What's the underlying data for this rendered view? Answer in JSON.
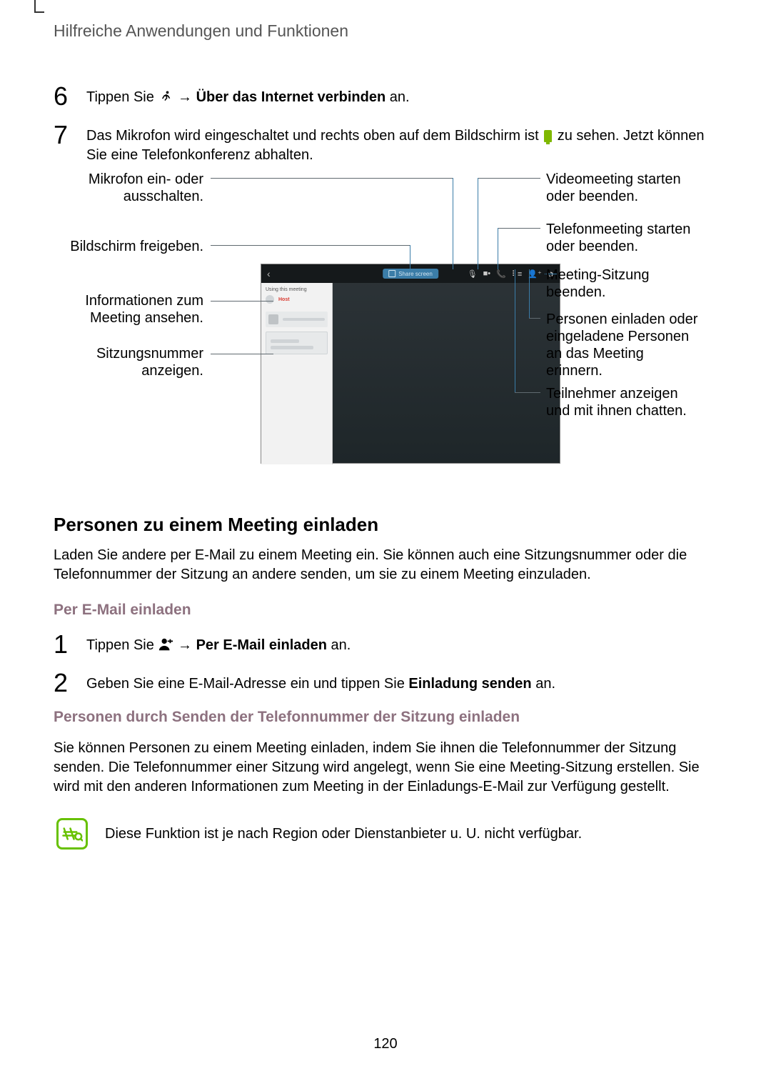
{
  "header": {
    "title": "Hilfreiche Anwendungen und Funktionen"
  },
  "step6": {
    "num": "6",
    "a": "Tippen Sie ",
    "arrow": "→",
    "b": "Über das Internet verbinden",
    "c": " an."
  },
  "step7": {
    "num": "7",
    "a": "Das Mikrofon wird eingeschaltet und rechts oben auf dem Bildschirm ist ",
    "b": " zu sehen. Jetzt können Sie eine Telefonkonferenz abhalten."
  },
  "callouts": {
    "left": {
      "mic": "Mikrofon ein- oder ausschalten.",
      "share": "Bildschirm freigeben.",
      "info": "Informationen zum Meeting ansehen.",
      "session_no": "Sitzungsnummer anzeigen."
    },
    "right": {
      "video": "Videomeeting starten oder beenden.",
      "phone": "Telefonmeeting starten oder beenden.",
      "end": "Meeting-Sitzung beenden.",
      "invite": "Personen einladen oder eingeladene Personen an das Meeting erinnern.",
      "participants_chat": "Teilnehmer anzeigen und mit ihnen chatten."
    }
  },
  "shot": {
    "share_label": "Share screen",
    "side_title": "Using this meeting",
    "host_badge": "Host"
  },
  "section": {
    "heading": "Personen zu einem Meeting einladen",
    "intro": "Laden Sie andere per E-Mail zu einem Meeting ein. Sie können auch eine Sitzungsnummer oder die Telefonnummer der Sitzung an andere senden, um sie zu einem Meeting einzuladen."
  },
  "email": {
    "heading": "Per E-Mail einladen",
    "step1": {
      "num": "1",
      "a": "Tippen Sie ",
      "arrow": "→",
      "b": "Per E-Mail einladen",
      "c": " an."
    },
    "step2": {
      "num": "2",
      "a": "Geben Sie eine E-Mail-Adresse ein und tippen Sie ",
      "b": "Einladung senden",
      "c": " an."
    }
  },
  "phone_invite": {
    "heading": "Personen durch Senden der Telefonnummer der Sitzung einladen",
    "body": "Sie können Personen zu einem Meeting einladen, indem Sie ihnen die Telefonnummer der Sitzung senden. Die Telefonnummer einer Sitzung wird angelegt, wenn Sie eine Meeting-Sitzung erstellen. Sie wird mit den anderen Informationen zum Meeting in der Einladungs-E-Mail zur Verfügung gestellt."
  },
  "note": {
    "text": "Diese Funktion ist je nach Region oder Dienstanbieter u. U. nicht verfügbar."
  },
  "page_number": "120"
}
